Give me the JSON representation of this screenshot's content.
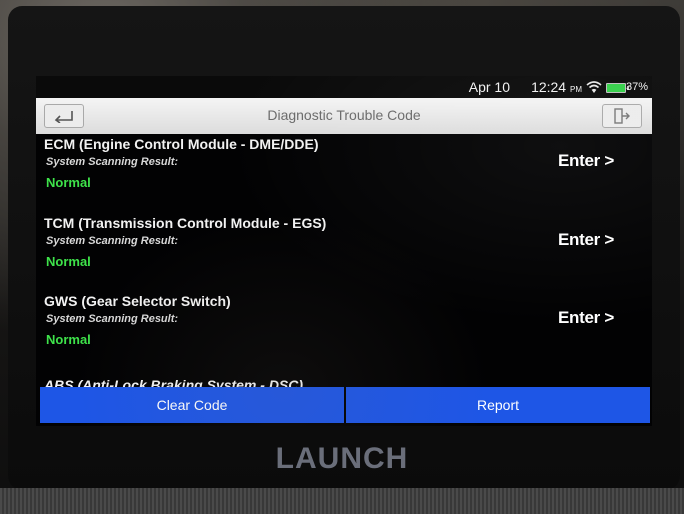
{
  "status_bar": {
    "date": "Apr 10",
    "time": "12:24",
    "meridiem": "PM",
    "battery": "37%"
  },
  "header": {
    "title": "Diagnostic Trouble Code",
    "back_icon": "back-arrow-icon",
    "exit_icon": "exit-icon"
  },
  "modules": [
    {
      "name": "ECM (Engine Control Module - DME/DDE)",
      "scan_label": "System Scanning Result:",
      "result": "Normal",
      "enter": "Enter >"
    },
    {
      "name": "TCM (Transmission Control Module - EGS)",
      "scan_label": "System Scanning Result:",
      "result": "Normal",
      "enter": "Enter >"
    },
    {
      "name": "GWS (Gear Selector Switch)",
      "scan_label": "System Scanning Result:",
      "result": "Normal",
      "enter": "Enter >"
    },
    {
      "name": "ABS (Anti-Lock Braking System - DSC)"
    }
  ],
  "actions": {
    "clear_code": "Clear Code",
    "report": "Report"
  },
  "brand": "LAUNCH",
  "colors": {
    "accent_blue": "#1e56e6",
    "normal_green": "#3ee24a",
    "battery_green": "#35d04a"
  }
}
